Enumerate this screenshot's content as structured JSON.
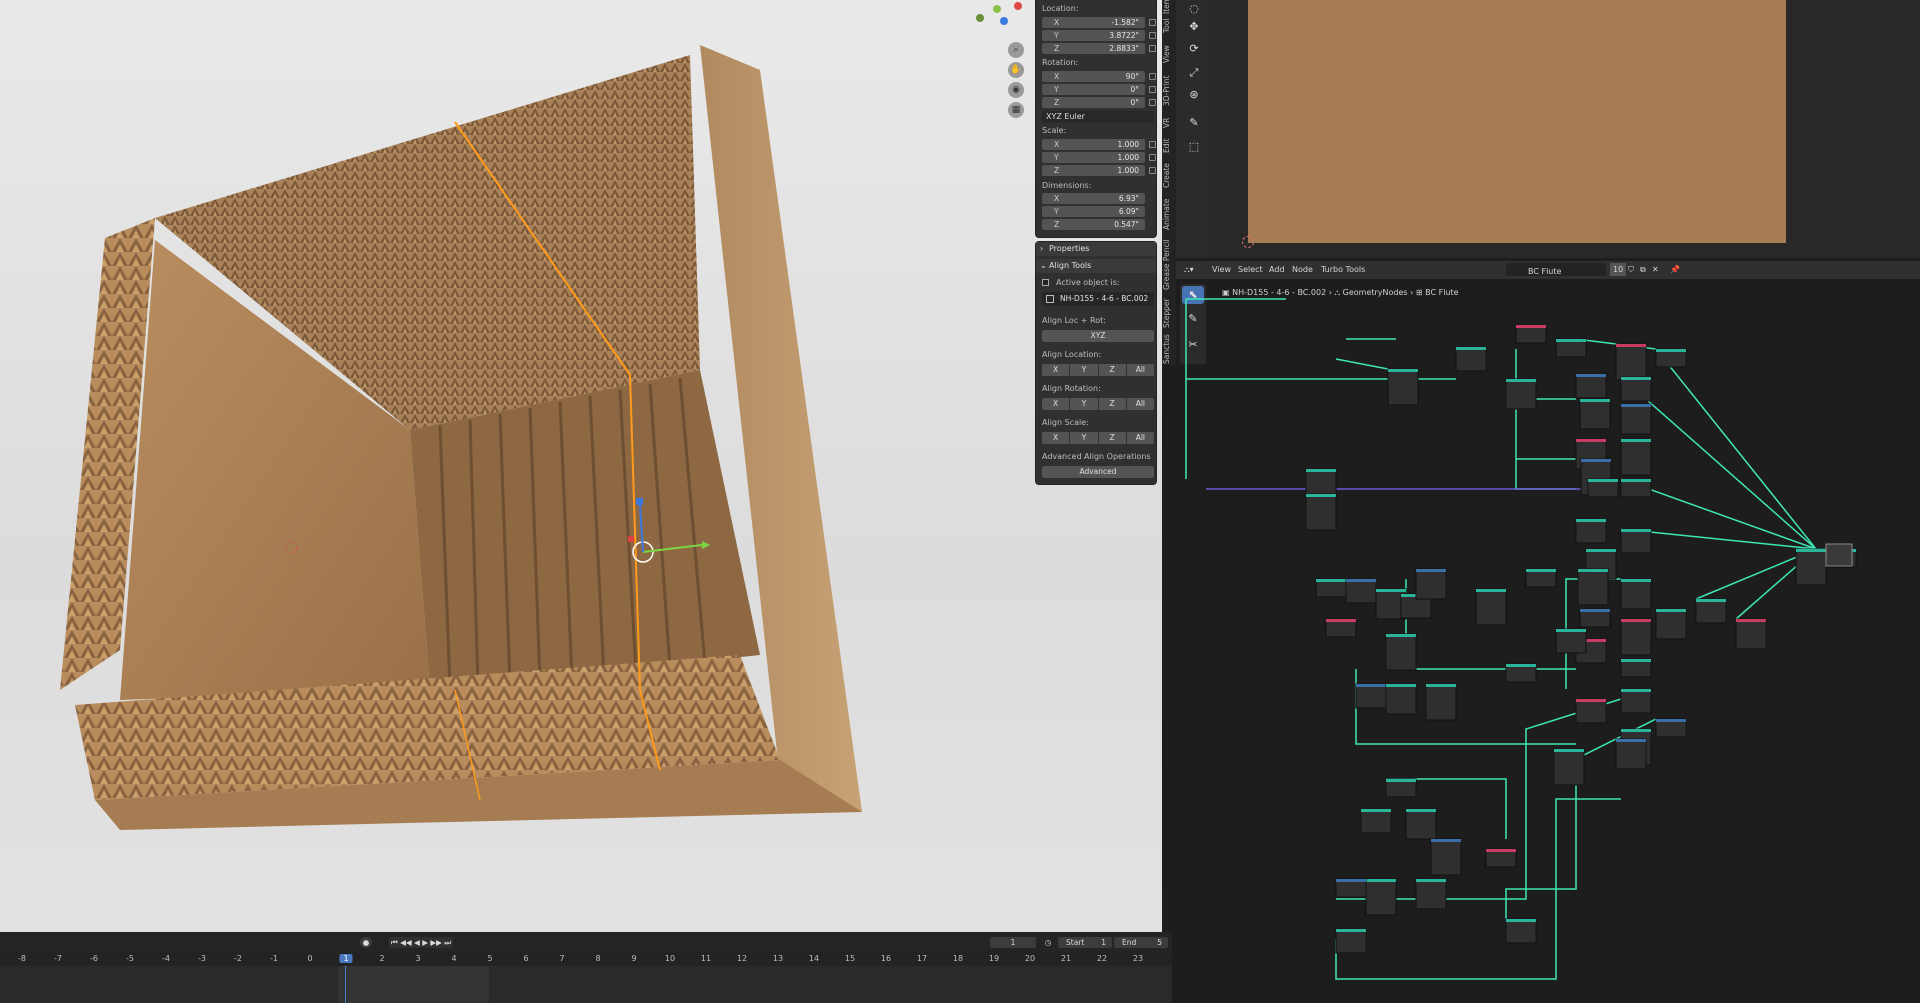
{
  "npanel": {
    "location_label": "Location:",
    "location": [
      {
        "axis": "X",
        "value": "-1.582\""
      },
      {
        "axis": "Y",
        "value": "3.8722\""
      },
      {
        "axis": "Z",
        "value": "2.8833\""
      }
    ],
    "rotation_label": "Rotation:",
    "rotation": [
      {
        "axis": "X",
        "value": "90°"
      },
      {
        "axis": "Y",
        "value": "0°"
      },
      {
        "axis": "Z",
        "value": "0°"
      }
    ],
    "rotation_mode": "XYZ Euler",
    "scale_label": "Scale:",
    "scale": [
      {
        "axis": "X",
        "value": "1.000"
      },
      {
        "axis": "Y",
        "value": "1.000"
      },
      {
        "axis": "Z",
        "value": "1.000"
      }
    ],
    "dimensions_label": "Dimensions:",
    "dimensions": [
      {
        "axis": "X",
        "value": "6.93\""
      },
      {
        "axis": "Y",
        "value": "6.09\""
      },
      {
        "axis": "Z",
        "value": "0.547\""
      }
    ]
  },
  "align": {
    "properties_header": "Properties",
    "header": "Align Tools",
    "active_label": "Active object is:",
    "active_object": "NH-D155 - 4-6 - BC.002",
    "loc_rot_label": "Align Loc + Rot:",
    "xyz_button": "XYZ",
    "location_label": "Align Location:",
    "rotation_label": "Align Rotation:",
    "scale_label": "Align Scale:",
    "axes": [
      "X",
      "Y",
      "Z",
      "All"
    ],
    "advanced_label": "Advanced Align Operations",
    "advanced_button": "Advanced"
  },
  "side_tabs": [
    "Item",
    "Tool",
    "View",
    "3D-Print",
    "VR",
    "Edit",
    "Create",
    "Animate",
    "Grease Pencil",
    "Stepper",
    "Sanctus"
  ],
  "node_editor": {
    "menu": [
      "View",
      "Select",
      "Add",
      "Node",
      "Turbo Tools"
    ],
    "node_group": "BC Flute",
    "users": "10",
    "breadcrumb": [
      "NH-D155 - 4-6 - BC.002",
      "GeometryNodes",
      "BC Flute"
    ]
  },
  "timeline": {
    "current_frame": "1",
    "start_label": "Start",
    "start_value": "1",
    "end_label": "End",
    "end_value": "5",
    "frame_numbers": [
      "-8",
      "-7",
      "-6",
      "-5",
      "-4",
      "-3",
      "-2",
      "-1",
      "0",
      "1",
      "2",
      "3",
      "4",
      "5",
      "6",
      "7",
      "8",
      "9",
      "10",
      "11",
      "12",
      "13",
      "14",
      "15",
      "16",
      "17",
      "18",
      "19",
      "20",
      "21",
      "22",
      "23"
    ]
  },
  "colors": {
    "cardboard": "#a57c53",
    "wire": "#3ee6b4",
    "selection": "#ff9a1a",
    "frame_cursor": "#4a78c2"
  }
}
